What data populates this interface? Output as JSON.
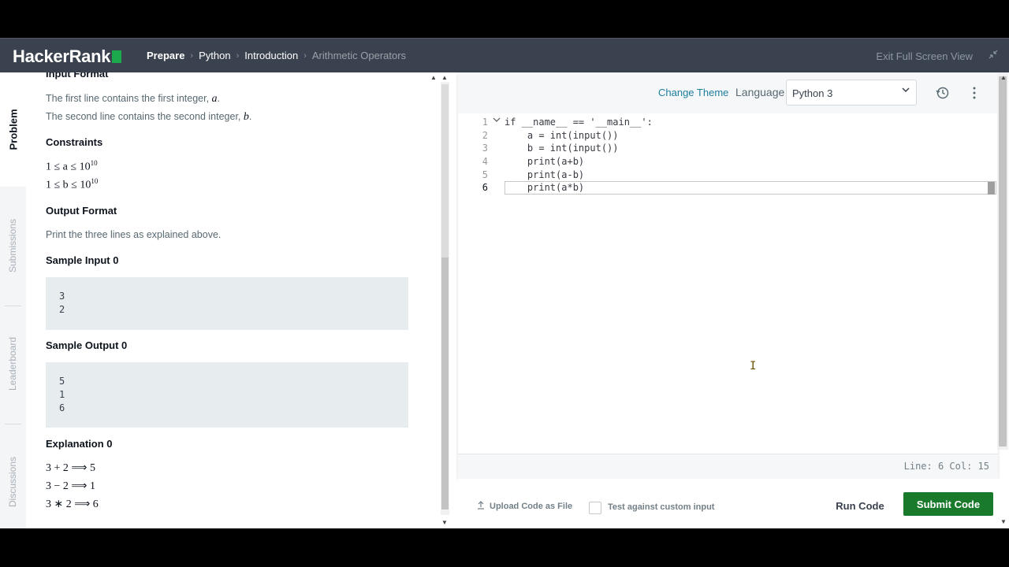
{
  "header": {
    "logo": "HackerRank",
    "breadcrumbs": [
      "Prepare",
      "Python",
      "Introduction",
      "Arithmetic Operators"
    ],
    "exit_fullscreen": "Exit Full Screen View"
  },
  "sidebar": {
    "tabs": [
      "Problem",
      "Submissions",
      "Leaderboard",
      "Discussions"
    ]
  },
  "problem": {
    "input_format_heading": "Input Format",
    "input_line1_text": "The first line contains the first integer, ",
    "input_line1_var": "a",
    "input_line2_text": "The second line contains the second integer, ",
    "input_line2_var": "b",
    "constraints_heading": "Constraints",
    "constraints": [
      "1 ≤ a ≤ 10",
      "1 ≤ b ≤ 10"
    ],
    "constraint_exp": "10",
    "output_format_heading": "Output Format",
    "output_format_text": "Print the three lines as explained above.",
    "sample_input_heading": "Sample Input 0",
    "sample_input": [
      "3",
      "2"
    ],
    "sample_output_heading": "Sample Output 0",
    "sample_output": [
      "5",
      "1",
      "6"
    ],
    "explanation_heading": "Explanation 0",
    "explanation": [
      "3 + 2 ⟹ 5",
      "3 − 2 ⟹ 1",
      "3 ∗ 2 ⟹ 6"
    ]
  },
  "editor": {
    "change_theme": "Change Theme",
    "language_label": "Language",
    "language_value": "Python 3",
    "code_lines": [
      "if __name__ == '__main__':",
      "    a = int(input())",
      "    b = int(input())",
      "    print(a+b)",
      "    print(a-b)",
      "    print(a*b)"
    ],
    "line_numbers": [
      "1",
      "2",
      "3",
      "4",
      "5",
      "6"
    ],
    "status": "Line: 6 Col: 15"
  },
  "actions": {
    "upload_label": "Upload Code as File",
    "custom_input_label": "Test against custom input",
    "run_label": "Run Code",
    "submit_label": "Submit Code"
  },
  "colors": {
    "navbar": "#39424e",
    "submit": "#1a7a2c",
    "logo_accent": "#1ba94c"
  }
}
